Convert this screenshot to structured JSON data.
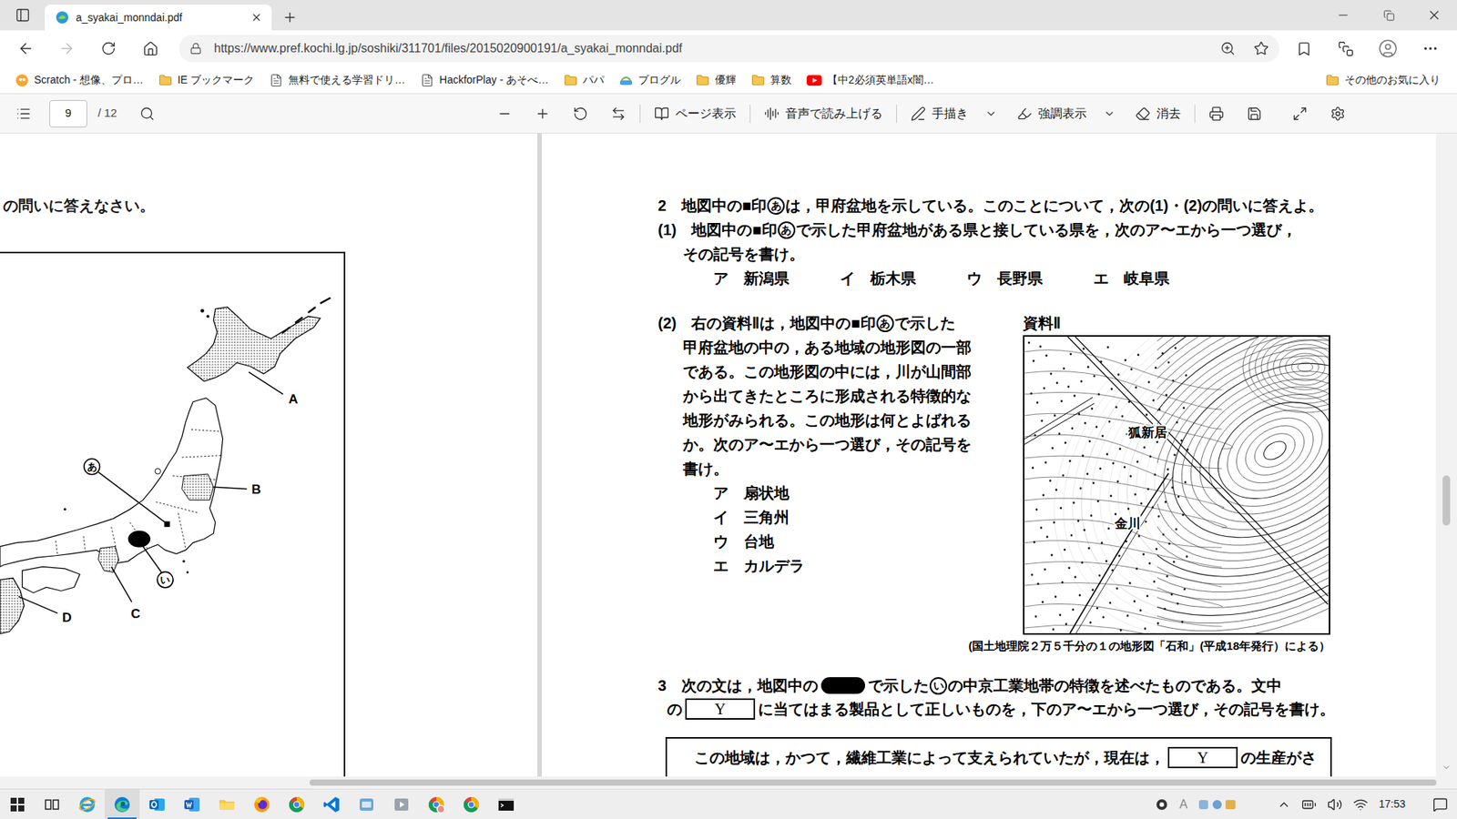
{
  "browser": {
    "tab": {
      "title": "a_syakai_monndai.pdf",
      "selected": true
    },
    "address": {
      "url": "https://www.pref.kochi.lg.jp/soshiki/311701/files/2015020900191/a_syakai_monndai.pdf",
      "forward_disabled": true
    },
    "bookmarks": [
      {
        "label": "Scratch - 想像、プロ…",
        "kind": "scratch"
      },
      {
        "label": "IE ブックマーク",
        "kind": "folder"
      },
      {
        "label": "無料で使える学習ドリ…",
        "kind": "page"
      },
      {
        "label": "HackforPlay - あそべ…",
        "kind": "page"
      },
      {
        "label": "パパ",
        "kind": "folder"
      },
      {
        "label": "ブログル",
        "kind": "blog"
      },
      {
        "label": "優輝",
        "kind": "folder"
      },
      {
        "label": "算数",
        "kind": "folder"
      },
      {
        "label": "【中2必須英単語x闇…",
        "kind": "video"
      }
    ],
    "other_bookmarks": "その他のお気に入り"
  },
  "pdf_toolbar": {
    "page": "9",
    "total": "/ 12",
    "actions": [
      {
        "label": "ページ表示",
        "kind": "page-view",
        "menu": false
      },
      {
        "label": "音声で読み上げる",
        "kind": "read-aloud",
        "menu": false
      },
      {
        "label": "手描き",
        "kind": "draw",
        "menu": true
      },
      {
        "label": "強調表示",
        "kind": "highlight",
        "menu": true
      },
      {
        "label": "消去",
        "kind": "erase",
        "menu": false
      }
    ]
  },
  "left_page": {
    "heading": "の問いに答えなさい。",
    "map_labels": [
      {
        "text": "A",
        "kind": "letter"
      },
      {
        "text": "B",
        "kind": "letter"
      },
      {
        "text": "C",
        "kind": "letter"
      },
      {
        "text": "D",
        "kind": "letter"
      },
      {
        "text": "あ",
        "kind": "circled"
      },
      {
        "text": "い",
        "kind": "circled"
      }
    ]
  },
  "right_page": {
    "q2": {
      "heading": [
        {
          "kind": "text",
          "text": "2　地図中の■印"
        },
        {
          "kind": "circled",
          "text": "あ"
        },
        {
          "kind": "text",
          "text": "は，甲府盆地を示している。このことについて，次の(1)・(2)の問いに答えよ。"
        }
      ],
      "sub1": {
        "lines": [
          [
            {
              "kind": "text",
              "text": "(1)　地図中の■印"
            },
            {
              "kind": "circled",
              "text": "あ"
            },
            {
              "kind": "text",
              "text": "で示した甲府盆地がある県と接している県を，次のア〜エから一つ選び，"
            }
          ],
          [
            {
              "kind": "text",
              "text": "その記号を書け。"
            }
          ]
        ],
        "options": [
          {
            "mark": "ア",
            "text": "新潟県"
          },
          {
            "mark": "イ",
            "text": "栃木県"
          },
          {
            "mark": "ウ",
            "text": "長野県"
          },
          {
            "mark": "エ",
            "text": "岐阜県"
          }
        ]
      },
      "sub2": {
        "lines": [
          [
            {
              "kind": "text",
              "text": "(2)　右の資料Ⅱは，地図中の■印"
            },
            {
              "kind": "circled",
              "text": "あ"
            },
            {
              "kind": "text",
              "text": "で示した"
            }
          ],
          [
            {
              "kind": "text",
              "text": "甲府盆地の中の，ある地域の地形図の一部"
            }
          ],
          [
            {
              "kind": "text",
              "text": "である。この地形図の中には，川が山間部"
            }
          ],
          [
            {
              "kind": "text",
              "text": "から出てきたところに形成される特徴的な"
            }
          ],
          [
            {
              "kind": "text",
              "text": "地形がみられる。この地形は何とよばれる"
            }
          ],
          [
            {
              "kind": "text",
              "text": "か。次のア〜エから一つ選び，その記号を"
            }
          ],
          [
            {
              "kind": "text",
              "text": "書け。"
            }
          ]
        ],
        "options": [
          {
            "mark": "ア",
            "text": "扇状地"
          },
          {
            "mark": "イ",
            "text": "三角州"
          },
          {
            "mark": "ウ",
            "text": "台地"
          },
          {
            "mark": "エ",
            "text": "カルデラ"
          }
        ],
        "figure": {
          "label": "資料Ⅱ",
          "map_labels": [
            "狐新居",
            "金川"
          ],
          "caption": "(国土地理院２万５千分の１の地形図「石和」(平成18年発行）による）"
        }
      }
    },
    "q3": {
      "lines": [
        [
          {
            "kind": "text",
            "text": "3　次の文は，地図中の"
          },
          {
            "kind": "blot"
          },
          {
            "kind": "text",
            "text": "で示した"
          },
          {
            "kind": "circled",
            "text": "い"
          },
          {
            "kind": "text",
            "text": "の中京工業地帯の特徴を述べたものである。文中"
          }
        ],
        [
          {
            "kind": "text",
            "text": "の"
          },
          {
            "kind": "blank",
            "text": "Y"
          },
          {
            "kind": "text",
            "text": "に当てはまる製品として正しいものを，下のア〜エから一つ選び，その記号を書け。"
          }
        ]
      ],
      "box_line": [
        {
          "kind": "text",
          "text": "この地域は，かつて，繊維工業によって支えられていたが，現在は，"
        },
        {
          "kind": "blank",
          "text": "Y"
        },
        {
          "kind": "text",
          "text": "の生産がさ"
        }
      ]
    }
  },
  "scroll": {
    "vertical": 0.54,
    "horizontal": 0.21
  },
  "taskbar": {
    "apps": [
      {
        "kind": "ie",
        "active": false
      },
      {
        "kind": "edge",
        "active": true
      },
      {
        "kind": "outlook",
        "active": false
      },
      {
        "kind": "word",
        "active": false
      },
      {
        "kind": "explorer",
        "active": false
      },
      {
        "kind": "firefox",
        "active": false
      },
      {
        "kind": "chrome",
        "active": false
      },
      {
        "kind": "vscode",
        "active": false
      },
      {
        "kind": "app",
        "active": false
      },
      {
        "kind": "media",
        "active": false
      },
      {
        "kind": "chrome-user",
        "active": false
      },
      {
        "kind": "chrome",
        "active": false
      },
      {
        "kind": "terminal",
        "active": false
      }
    ],
    "ime": "A",
    "time": "17:53"
  }
}
